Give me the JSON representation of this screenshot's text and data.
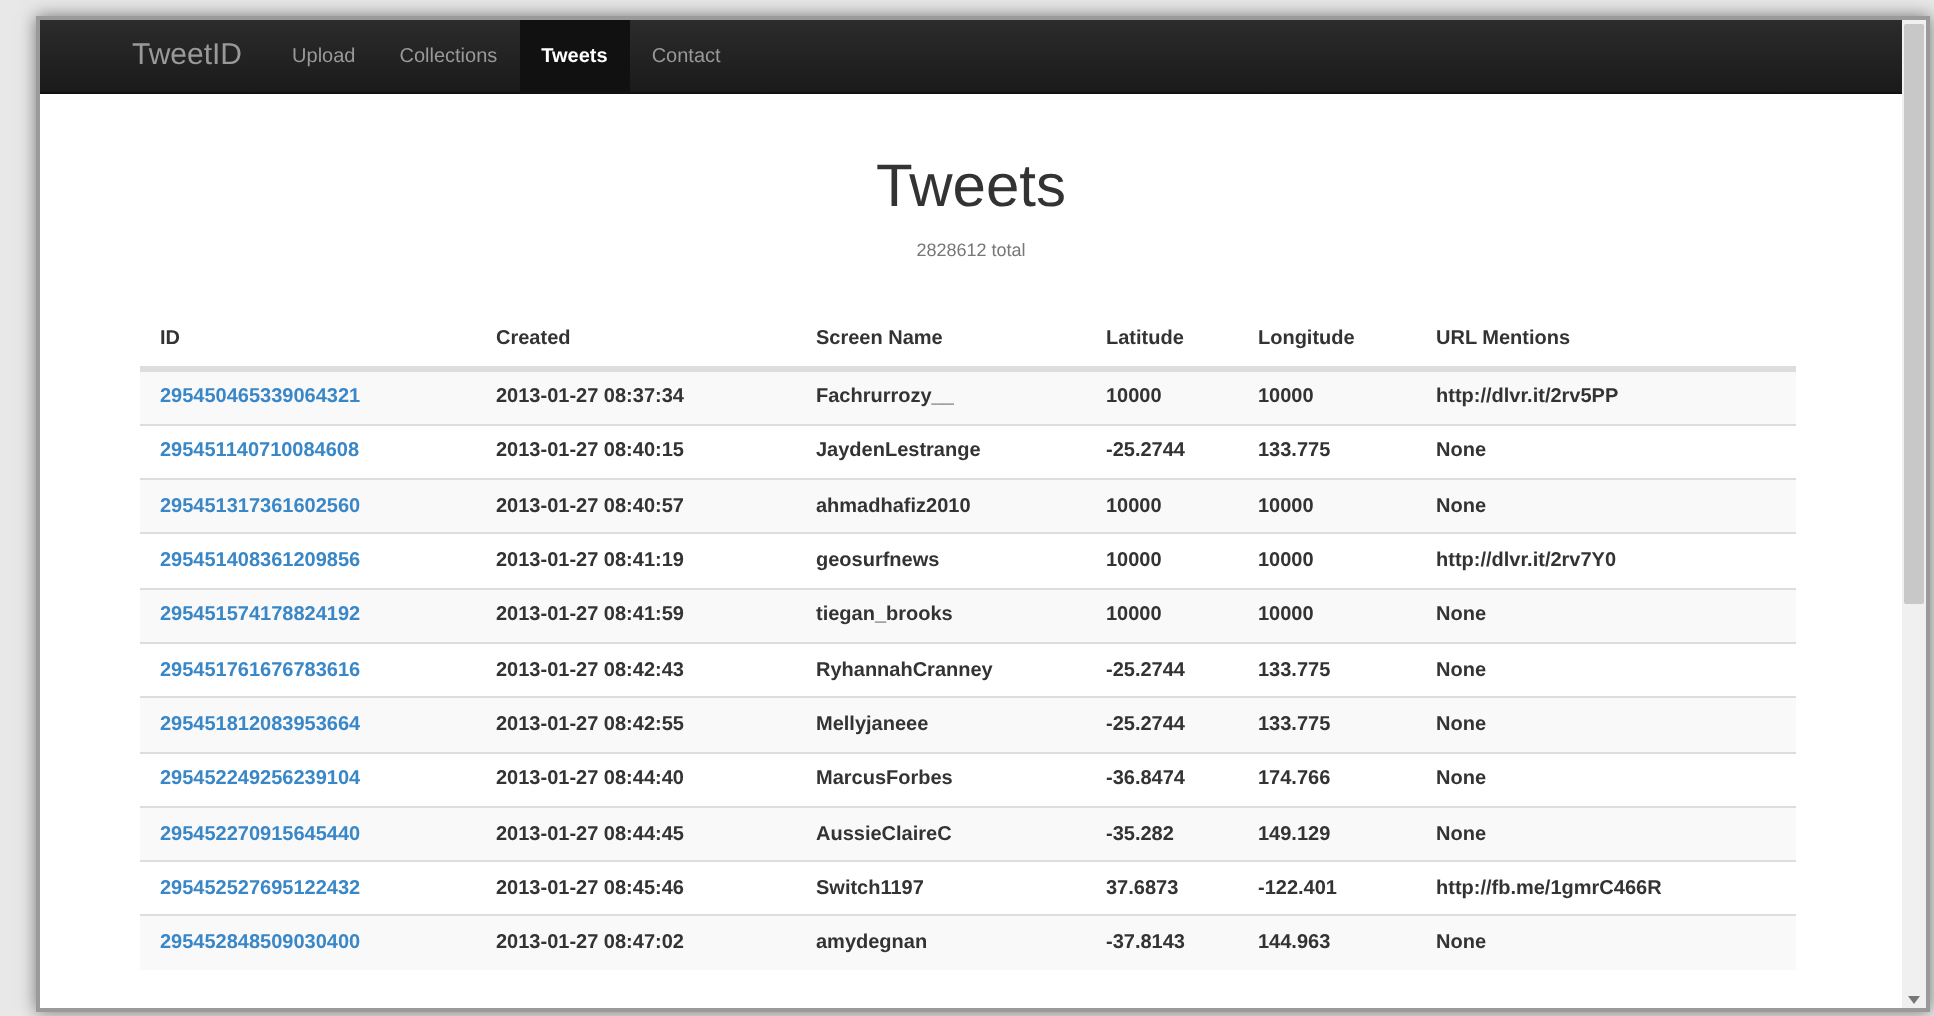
{
  "navbar": {
    "brand": "TweetID",
    "items": [
      {
        "label": "Upload",
        "selected": false
      },
      {
        "label": "Collections",
        "selected": false
      },
      {
        "label": "Tweets",
        "selected": true
      },
      {
        "label": "Contact",
        "selected": false
      }
    ]
  },
  "heading": "Tweets",
  "subtitle": "2828612 total",
  "table": {
    "columns": [
      "ID",
      "Created",
      "Screen Name",
      "Latitude",
      "Longitude",
      "URL Mentions"
    ],
    "rows": [
      [
        "295450465339064321",
        "2013-01-27 08:37:34",
        "Fachrurrozy__",
        "10000",
        "10000",
        "http://dlvr.it/2rv5PP"
      ],
      [
        "295451140710084608",
        "2013-01-27 08:40:15",
        "JaydenLestrange",
        "-25.2744",
        "133.775",
        "None"
      ],
      [
        "295451317361602560",
        "2013-01-27 08:40:57",
        "ahmadhafiz2010",
        "10000",
        "10000",
        "None"
      ],
      [
        "295451408361209856",
        "2013-01-27 08:41:19",
        "geosurfnews",
        "10000",
        "10000",
        "http://dlvr.it/2rv7Y0"
      ],
      [
        "295451574178824192",
        "2013-01-27 08:41:59",
        "tiegan_brooks",
        "10000",
        "10000",
        "None"
      ],
      [
        "295451761676783616",
        "2013-01-27 08:42:43",
        "RyhannahCranney",
        "-25.2744",
        "133.775",
        "None"
      ],
      [
        "295451812083953664",
        "2013-01-27 08:42:55",
        "Mellyjaneee",
        "-25.2744",
        "133.775",
        "None"
      ],
      [
        "295452249256239104",
        "2013-01-27 08:44:40",
        "MarcusForbes",
        "-36.8474",
        "174.766",
        "None"
      ],
      [
        "295452270915645440",
        "2013-01-27 08:44:45",
        "AussieClaireC",
        "-35.282",
        "149.129",
        "None"
      ],
      [
        "295452527695122432",
        "2013-01-27 08:45:46",
        "Switch1197",
        "37.6873",
        "-122.401",
        "http://fb.me/1gmrC466R"
      ],
      [
        "295452848509030400",
        "2013-01-27 08:47:02",
        "amydegnan",
        "-37.8143",
        "144.963",
        "None"
      ]
    ]
  }
}
